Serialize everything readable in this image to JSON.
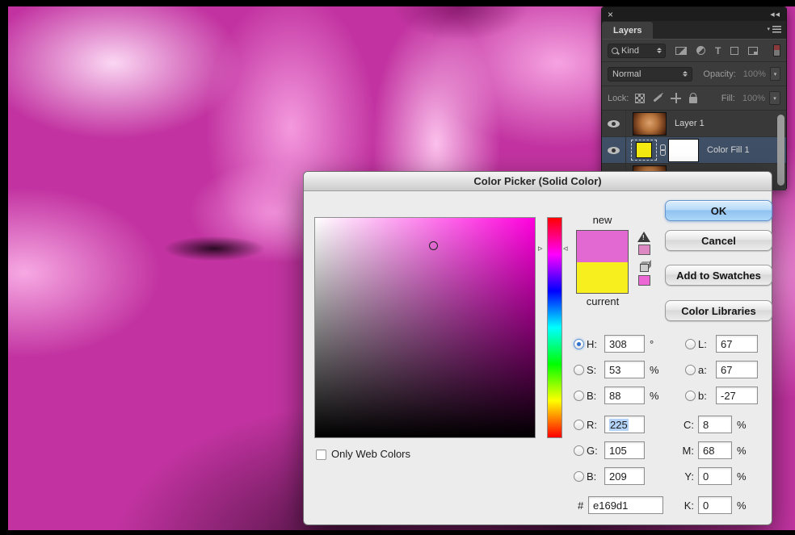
{
  "icons": {
    "close": "×",
    "collapse": "◀◀",
    "menu_tri": "▾",
    "arrow_down": "▾",
    "marker_right": "▹",
    "marker_left": "◃",
    "type_T": "T"
  },
  "layers_panel": {
    "tab": "Layers",
    "kind_label": "Kind",
    "blend_mode": "Normal",
    "opacity_label": "Opacity:",
    "opacity_value": "100%",
    "lock_label": "Lock:",
    "fill_label": "Fill:",
    "fill_value": "100%",
    "fill_swatch_color": "#f2ea10",
    "layers": [
      {
        "name": "Layer 1"
      },
      {
        "name": "Color Fill 1"
      }
    ]
  },
  "dialog": {
    "title": "Color Picker (Solid Color)",
    "ok": "OK",
    "cancel": "Cancel",
    "add_to_swatches": "Add to Swatches",
    "color_libraries": "Color Libraries",
    "new_label": "new",
    "current_label": "current",
    "only_web_colors": "Only Web Colors",
    "colors": {
      "new": "#e169d1",
      "current": "#f7f01e",
      "gamut_swatch": "#dd87c3",
      "web_swatch": "#ed66d6",
      "hue_degrees": "308"
    },
    "fields": {
      "h": {
        "label": "H:",
        "value": "308",
        "unit": "°"
      },
      "s": {
        "label": "S:",
        "value": "53",
        "unit": "%"
      },
      "b": {
        "label": "B:",
        "value": "88",
        "unit": "%"
      },
      "r": {
        "label": "R:",
        "value": "225"
      },
      "g": {
        "label": "G:",
        "value": "105"
      },
      "b2": {
        "label": "B:",
        "value": "209"
      },
      "hex": {
        "label": "#",
        "value": "e169d1"
      },
      "l": {
        "label": "L:",
        "value": "67"
      },
      "a": {
        "label": "a:",
        "value": "67"
      },
      "lab_b": {
        "label": "b:",
        "value": "-27"
      },
      "c": {
        "label": "C:",
        "value": "8",
        "unit": "%"
      },
      "m": {
        "label": "M:",
        "value": "68",
        "unit": "%"
      },
      "y": {
        "label": "Y:",
        "value": "0",
        "unit": "%"
      },
      "k": {
        "label": "K:",
        "value": "0",
        "unit": "%"
      }
    }
  }
}
